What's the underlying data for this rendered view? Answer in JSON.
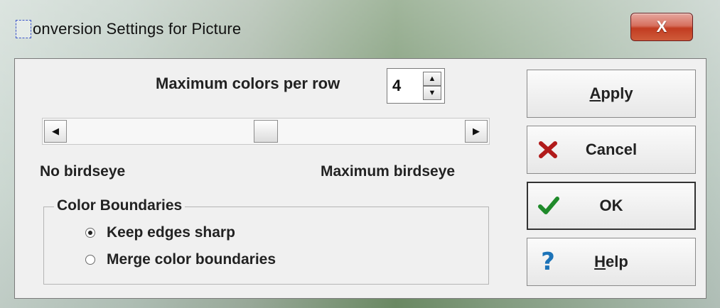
{
  "window": {
    "title": "onversion Settings for Picture",
    "close_label": "X"
  },
  "colors_per_row": {
    "label": "Maximum colors per row",
    "value": "4"
  },
  "slider": {
    "position": 0.5,
    "min_label": "No birdseye",
    "max_label": "Maximum birdseye"
  },
  "color_boundaries": {
    "legend": "Color Boundaries",
    "options": [
      {
        "label": "Keep edges sharp",
        "selected": true
      },
      {
        "label": "Merge color boundaries",
        "selected": false
      }
    ]
  },
  "buttons": {
    "apply": {
      "mnemonic": "A",
      "rest": "pply"
    },
    "cancel": {
      "label": "Cancel",
      "icon": "red-x-icon"
    },
    "ok": {
      "label": "OK",
      "icon": "green-check-icon"
    },
    "help": {
      "mnemonic": "H",
      "rest": "elp",
      "icon": "question-icon"
    }
  },
  "icon_colors": {
    "cancel": "#b11b1b",
    "ok": "#1f8a2a",
    "help": "#1c73b8"
  }
}
